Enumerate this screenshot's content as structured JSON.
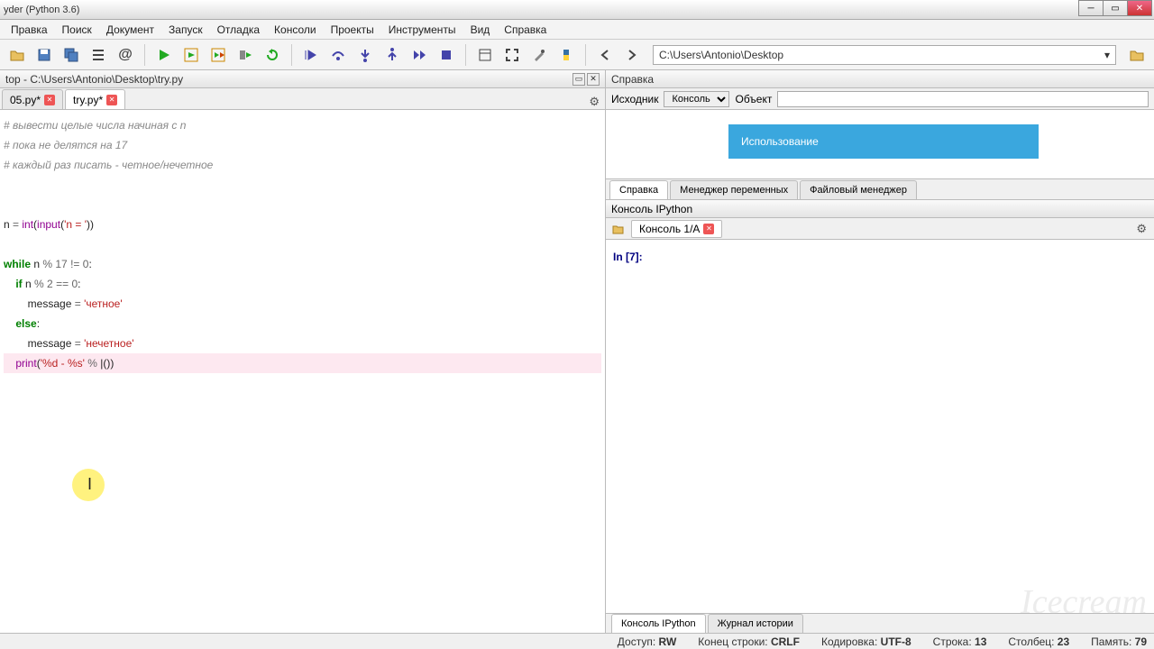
{
  "title": "yder (Python 3.6)",
  "menus": [
    "Правка",
    "Поиск",
    "Документ",
    "Запуск",
    "Отладка",
    "Консоли",
    "Проекты",
    "Инструменты",
    "Вид",
    "Справка"
  ],
  "address": "C:\\Users\\Antonio\\Desktop",
  "editor_path": "top - C:\\Users\\Antonio\\Desktop\\try.py",
  "tabs": [
    {
      "label": "05.py*",
      "active": false
    },
    {
      "label": "try.py*",
      "active": true
    }
  ],
  "code": [
    {
      "t": "cm",
      "s": "# вывести целые числа начиная с n"
    },
    {
      "t": "cm",
      "s": "# пока не делятся на 17"
    },
    {
      "t": "cm",
      "s": "# каждый раз писать - четное/нечетное"
    },
    {
      "t": "",
      "s": ""
    },
    {
      "t": "",
      "s": ""
    },
    {
      "t": "mix",
      "parts": [
        "n ",
        [
          "op",
          "= "
        ],
        [
          "bi",
          "int"
        ],
        "(",
        [
          "bi",
          "input"
        ],
        "(",
        [
          "st",
          "'n = '"
        ],
        "))"
      ]
    },
    {
      "t": "",
      "s": ""
    },
    {
      "t": "mix",
      "parts": [
        [
          "kw",
          "while"
        ],
        " n ",
        [
          "op",
          "%"
        ],
        " ",
        [
          "nm",
          "17"
        ],
        " ",
        [
          "op",
          "!="
        ],
        " ",
        [
          "nm",
          "0"
        ],
        ":"
      ]
    },
    {
      "t": "mix",
      "parts": [
        "    ",
        [
          "kw",
          "if"
        ],
        " n ",
        [
          "op",
          "%"
        ],
        " ",
        [
          "nm",
          "2"
        ],
        " ",
        [
          "op",
          "=="
        ],
        " ",
        [
          "nm",
          "0"
        ],
        ":"
      ]
    },
    {
      "t": "mix",
      "parts": [
        "        message ",
        [
          "op",
          "="
        ],
        " ",
        [
          "st",
          "'четное'"
        ]
      ]
    },
    {
      "t": "mix",
      "parts": [
        "    ",
        [
          "kw",
          "else"
        ],
        ":"
      ]
    },
    {
      "t": "mix",
      "parts": [
        "        message ",
        [
          "op",
          "="
        ],
        " ",
        [
          "st",
          "'нечетное'"
        ]
      ]
    },
    {
      "t": "mix",
      "hl": true,
      "parts": [
        "    ",
        [
          "bi",
          "print"
        ],
        "(",
        [
          "st",
          "'%d - %s'"
        ],
        " ",
        [
          "op",
          "%"
        ],
        " |())"
      ]
    }
  ],
  "help": {
    "pane_label": "Справка",
    "source_label": "Исходник",
    "source_value": "Консоль",
    "object_label": "Объект",
    "blue_tab": "Использование",
    "tabs": [
      "Справка",
      "Менеджер переменных",
      "Файловый менеджер"
    ]
  },
  "console": {
    "title": "Консоль IPython",
    "tab": "Консоль 1/A",
    "prompt": "In [7]:",
    "bottom_tabs": [
      "Консоль IPython",
      "Журнал истории"
    ]
  },
  "status": {
    "access_l": "Доступ:",
    "access_v": "RW",
    "eol_l": "Конец строки:",
    "eol_v": "CRLF",
    "enc_l": "Кодировка:",
    "enc_v": "UTF-8",
    "line_l": "Строка:",
    "line_v": "13",
    "col_l": "Столбец:",
    "col_v": "23",
    "mem_l": "Память:",
    "mem_v": "79"
  },
  "watermark": "Icecream"
}
